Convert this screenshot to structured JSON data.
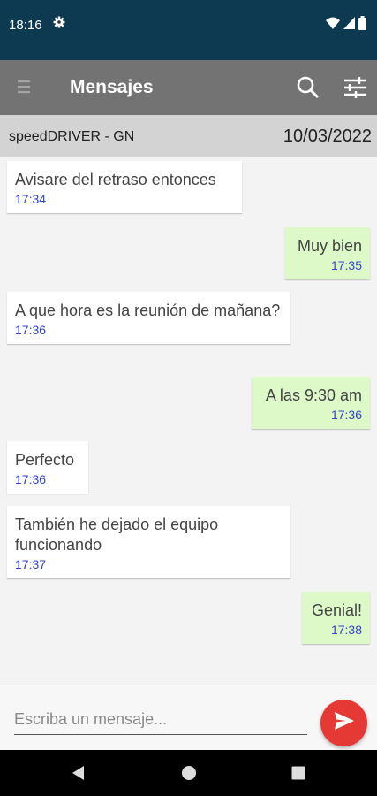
{
  "status_bar": {
    "time": "18:16"
  },
  "app_bar": {
    "title": "Mensajes"
  },
  "conversation": {
    "contact": "speedDRIVER - GN",
    "date": "10/03/2022"
  },
  "messages": [
    {
      "direction": "in",
      "text": "Avisare del retraso entonces",
      "time": "17:34"
    },
    {
      "direction": "out",
      "text": "Muy bien",
      "time": "17:35"
    },
    {
      "direction": "in",
      "text": "A que hora es la reunión de mañana?",
      "time": "17:36"
    },
    {
      "direction": "out",
      "text": "A las 9:30 am",
      "time": "17:36"
    },
    {
      "direction": "in",
      "text": "Perfecto",
      "time": "17:36"
    },
    {
      "direction": "in",
      "text": "También he dejado el equipo funcionando",
      "time": "17:37"
    },
    {
      "direction": "out",
      "text": "Genial!",
      "time": "17:38"
    }
  ],
  "composer": {
    "placeholder": "Escriba un mensaje..."
  },
  "colors": {
    "status_bar": "#0d3a50",
    "app_bar": "#737373",
    "incoming_bubble": "#ffffff",
    "outgoing_bubble": "#ddf9c8",
    "timestamp": "#3344cc",
    "send_button": "#e53935"
  },
  "icons": {
    "status": [
      "gear-icon",
      "wifi-icon",
      "cell-signal-icon",
      "battery-icon"
    ],
    "app_bar": [
      "menu-icon",
      "search-icon",
      "filter-icon"
    ],
    "composer": [
      "send-icon"
    ],
    "nav": [
      "back-icon",
      "home-icon",
      "recent-apps-icon"
    ]
  }
}
